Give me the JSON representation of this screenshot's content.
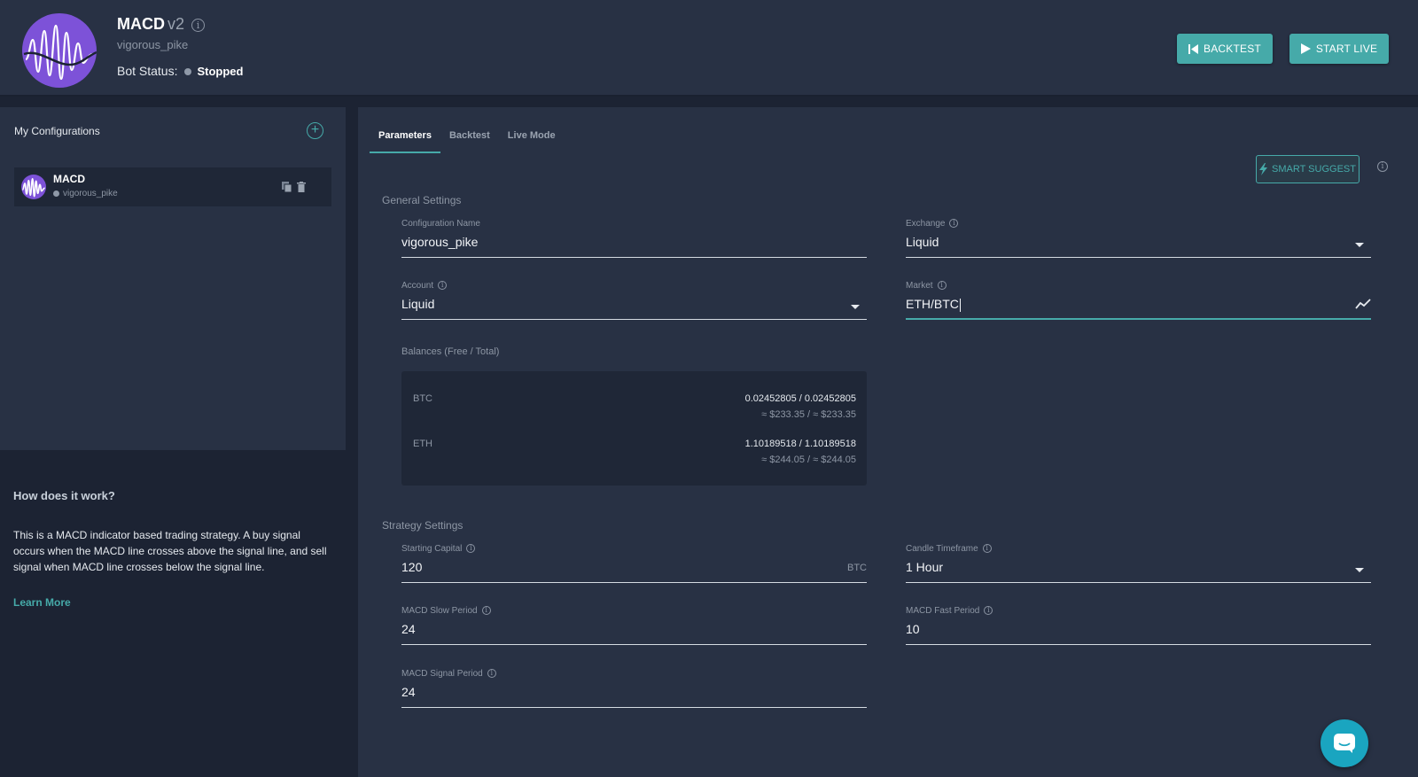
{
  "header": {
    "title": "MACD",
    "version": "v2",
    "subtitle": "vigorous_pike",
    "status_label": "Bot Status:",
    "status_value": "Stopped",
    "backtest_label": "BACKTEST",
    "start_live_label": "START LIVE"
  },
  "sidebar": {
    "title": "My Configurations",
    "configs": [
      {
        "name": "MACD",
        "sub": "vigorous_pike"
      }
    ],
    "how_title": "How does it work?",
    "how_text": "This is a MACD indicator based trading strategy. A buy signal occurs when the MACD line crosses above the signal line, and sell signal when MACD line crosses below the signal line.",
    "learn_more": "Learn More"
  },
  "tabs": [
    "Parameters",
    "Backtest",
    "Live Mode"
  ],
  "smart_suggest": "SMART SUGGEST",
  "general": {
    "title": "General Settings",
    "config_name_label": "Configuration Name",
    "config_name_value": "vigorous_pike",
    "exchange_label": "Exchange",
    "exchange_value": "Liquid",
    "account_label": "Account",
    "account_value": "Liquid",
    "market_label": "Market",
    "market_value": "ETH/BTC",
    "balances_title": "Balances (Free / Total)",
    "balances": [
      {
        "currency": "BTC",
        "amount": "0.02452805 / 0.02452805",
        "usd": "≈ $233.35 / ≈ $233.35"
      },
      {
        "currency": "ETH",
        "amount": "1.10189518 / 1.10189518",
        "usd": "≈ $244.05 / ≈ $244.05"
      }
    ]
  },
  "strategy": {
    "title": "Strategy Settings",
    "starting_capital_label": "Starting Capital",
    "starting_capital_value": "120",
    "starting_capital_unit": "BTC",
    "candle_label": "Candle Timeframe",
    "candle_value": "1 Hour",
    "slow_label": "MACD Slow Period",
    "slow_value": "24",
    "fast_label": "MACD Fast Period",
    "fast_value": "10",
    "signal_label": "MACD Signal Period",
    "signal_value": "24"
  },
  "colors": {
    "accent": "#46aaa9",
    "logo": "#7d52d8",
    "panel": "#283144",
    "background": "#1c2333"
  }
}
